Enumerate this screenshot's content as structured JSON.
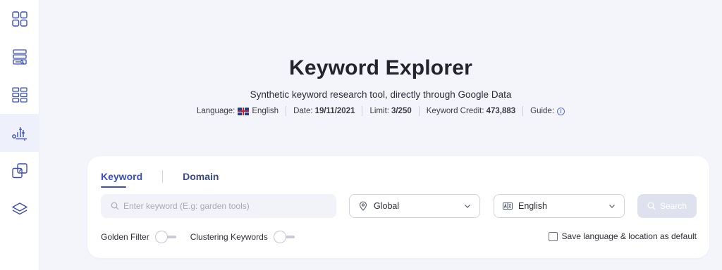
{
  "sidebar": {
    "items": [
      {
        "name": "dashboard-grid-icon",
        "active": false
      },
      {
        "name": "site-audit-icon",
        "active": false
      },
      {
        "name": "rank-tracker-icon",
        "active": false
      },
      {
        "name": "keyword-explorer-icon",
        "active": true
      },
      {
        "name": "domain-compare-icon",
        "active": false
      },
      {
        "name": "layers-icon",
        "active": false
      }
    ],
    "accent": "#3b4fb8"
  },
  "header": {
    "title": "Keyword Explorer",
    "subtitle": "Synthetic keyword research tool, directly through Google Data"
  },
  "meta": {
    "language_label": "Language:",
    "language_value": "English",
    "date_label": "Date:",
    "date_value": "19/11/2021",
    "limit_label": "Limit:",
    "limit_value": "3/250",
    "credit_label": "Keyword Credit:",
    "credit_value": "473,883",
    "guide_label": "Guide:"
  },
  "search_card": {
    "tabs": [
      {
        "label": "Keyword",
        "active": true
      },
      {
        "label": "Domain",
        "active": false
      }
    ],
    "keyword_input": {
      "placeholder": "Enter keyword (E.g: garden tools)",
      "value": ""
    },
    "location_select": {
      "value": "Global"
    },
    "language_select": {
      "value": "English"
    },
    "search_button": {
      "label": "Search",
      "enabled": false
    },
    "golden_filter_label": "Golden Filter",
    "clustering_label": "Clustering Keywords",
    "golden_filter_on": false,
    "clustering_on": false,
    "save_default_label": "Save language & location as default",
    "save_default_checked": false
  }
}
